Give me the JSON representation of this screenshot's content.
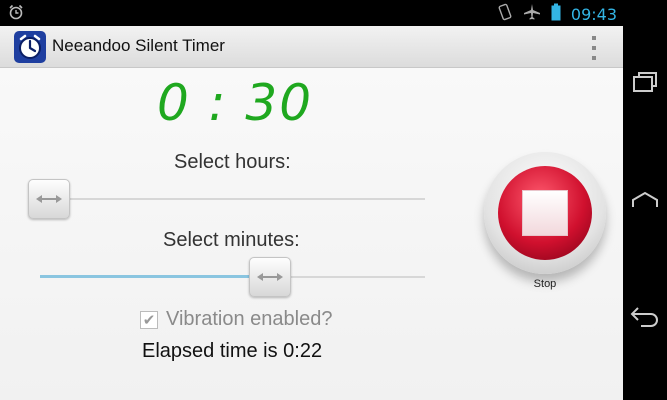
{
  "status_bar": {
    "time": "09:43",
    "icons": [
      "alarm-clock-icon",
      "vibrate-icon",
      "airplane-mode-icon",
      "battery-icon"
    ]
  },
  "action_bar": {
    "title": "Neeandoo Silent Timer",
    "app_icon": "timer-app-icon",
    "overflow_icon": "overflow-menu-icon"
  },
  "timer": {
    "display": "0 : 30"
  },
  "hours": {
    "label": "Select hours:",
    "value_fraction": 0.0
  },
  "minutes": {
    "label": "Select minutes:",
    "value_fraction": 0.6
  },
  "vibration": {
    "label": "Vibration enabled?",
    "checked": true
  },
  "elapsed": {
    "text": "Elapsed time is 0:22"
  },
  "stop_button": {
    "label": "Stop"
  },
  "nav_bar": {
    "icons": [
      "recent-apps-icon",
      "home-icon",
      "back-icon"
    ]
  },
  "colors": {
    "timer_green": "#1fa81f",
    "stop_red": "#d0102e",
    "status_time_blue": "#33b5e5",
    "slider_fill": "#8ac5e0"
  }
}
